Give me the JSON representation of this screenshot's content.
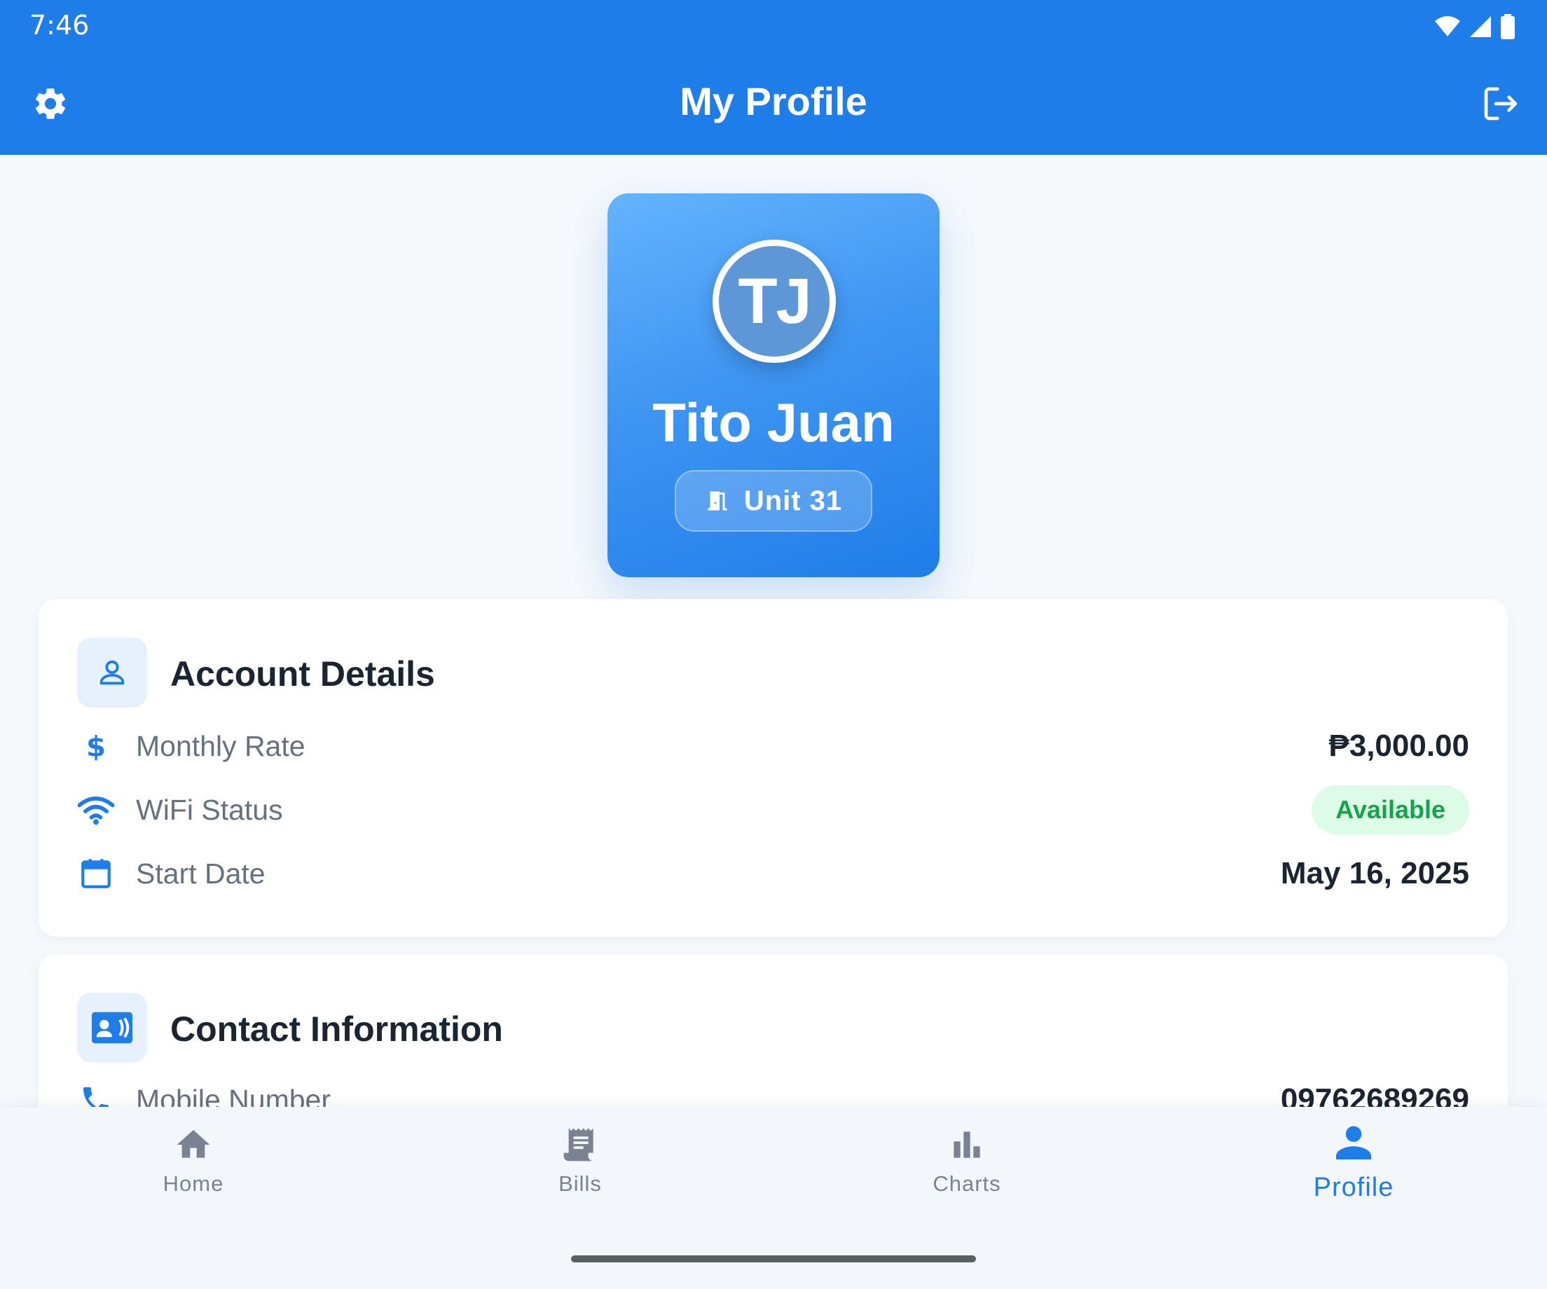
{
  "status_bar": {
    "time": "7:46"
  },
  "appbar": {
    "title": "My Profile"
  },
  "profile": {
    "initials": "TJ",
    "name": "Tito Juan",
    "unit": "Unit 31"
  },
  "account_details": {
    "title": "Account Details",
    "rows": [
      {
        "label": "Monthly Rate",
        "value": "₱3,000.00",
        "icon": "dollar-icon"
      },
      {
        "label": "WiFi Status",
        "value": "Available",
        "icon": "wifi-icon"
      },
      {
        "label": "Start Date",
        "value": "May 16, 2025",
        "icon": "calendar-icon"
      }
    ]
  },
  "contact_information": {
    "title": "Contact Information",
    "rows": [
      {
        "label": "Mobile Number",
        "value": "09762689269",
        "icon": "phone-icon"
      }
    ]
  },
  "bottom_nav": {
    "items": [
      {
        "label": "Home",
        "icon": "home-icon"
      },
      {
        "label": "Bills",
        "icon": "receipt-icon"
      },
      {
        "label": "Charts",
        "icon": "bar-chart-icon"
      },
      {
        "label": "Profile",
        "icon": "person-icon",
        "active": true
      }
    ]
  },
  "colors": {
    "primary": "#1f7de9",
    "success_text": "#16a34a",
    "success_bg": "#dcfce7",
    "background": "#f6f9fc"
  }
}
